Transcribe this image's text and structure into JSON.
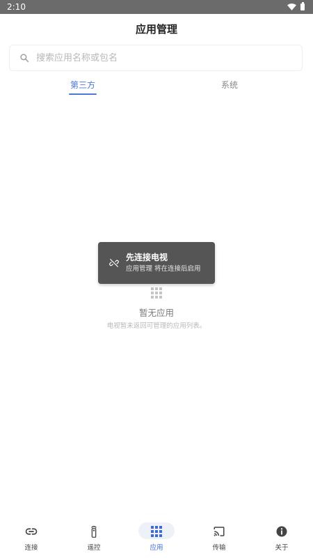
{
  "status_bar": {
    "time": "2:10"
  },
  "header": {
    "title": "应用管理"
  },
  "search": {
    "placeholder": "搜索应用名称或包名"
  },
  "tabs": [
    {
      "label": "第三方",
      "active": true
    },
    {
      "label": "系统",
      "active": false
    }
  ],
  "toast": {
    "title": "先连接电视",
    "message": "应用管理 将在连接后启用",
    "icon": "link-off-icon"
  },
  "empty_state": {
    "icon": "apps-grid-icon",
    "title": "暂无应用",
    "description": "电视暂未返回可管理的应用列表。"
  },
  "bottom_nav": [
    {
      "label": "连接",
      "icon": "link-icon",
      "active": false
    },
    {
      "label": "遥控",
      "icon": "remote-icon",
      "active": false
    },
    {
      "label": "应用",
      "icon": "apps-icon",
      "active": true
    },
    {
      "label": "传输",
      "icon": "cast-icon",
      "active": false
    },
    {
      "label": "关于",
      "icon": "info-icon",
      "active": false
    }
  ],
  "colors": {
    "accent": "#4a78d8",
    "status_bar": "#6b6b6b",
    "toast_bg": "#555555"
  }
}
